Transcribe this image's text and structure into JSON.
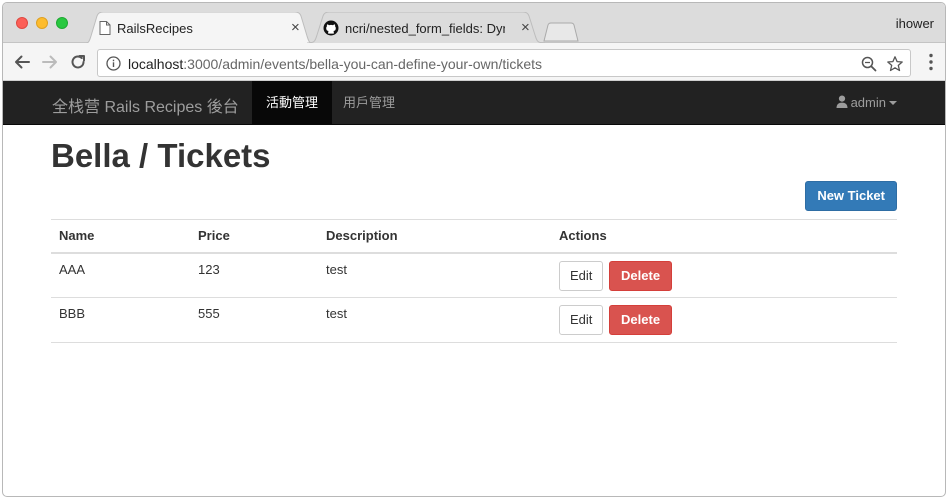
{
  "browser": {
    "tabs": [
      {
        "title": "RailsRecipes",
        "close": "×"
      },
      {
        "title": "ncri/nested_form_fields: Dynam",
        "close": "×"
      }
    ],
    "profile": "ihower",
    "url_host": "localhost",
    "url_path": ":3000/admin/events/bella-you-can-define-your-own/tickets"
  },
  "navbar": {
    "brand": "全栈营 Rails Recipes 後台",
    "items": [
      {
        "label": "活動管理",
        "active": true
      },
      {
        "label": "用戶管理",
        "active": false
      }
    ],
    "user": "admin"
  },
  "page": {
    "title": "Bella / Tickets",
    "new_button": "New Ticket"
  },
  "table": {
    "headers": [
      "Name",
      "Price",
      "Description",
      "Actions"
    ],
    "rows": [
      {
        "name": "AAA",
        "price": "123",
        "description": "test",
        "edit": "Edit",
        "delete": "Delete"
      },
      {
        "name": "BBB",
        "price": "555",
        "description": "test",
        "edit": "Edit",
        "delete": "Delete"
      }
    ]
  },
  "colors": {
    "navbar_bg": "#222222",
    "primary": "#337ab7",
    "danger": "#d9534f"
  },
  "icons": [
    "page-icon",
    "github-icon",
    "back-arrow-icon",
    "forward-arrow-icon",
    "reload-icon",
    "info-icon",
    "zoom-icon",
    "star-icon",
    "menu-icon",
    "user-icon",
    "caret-down-icon"
  ]
}
